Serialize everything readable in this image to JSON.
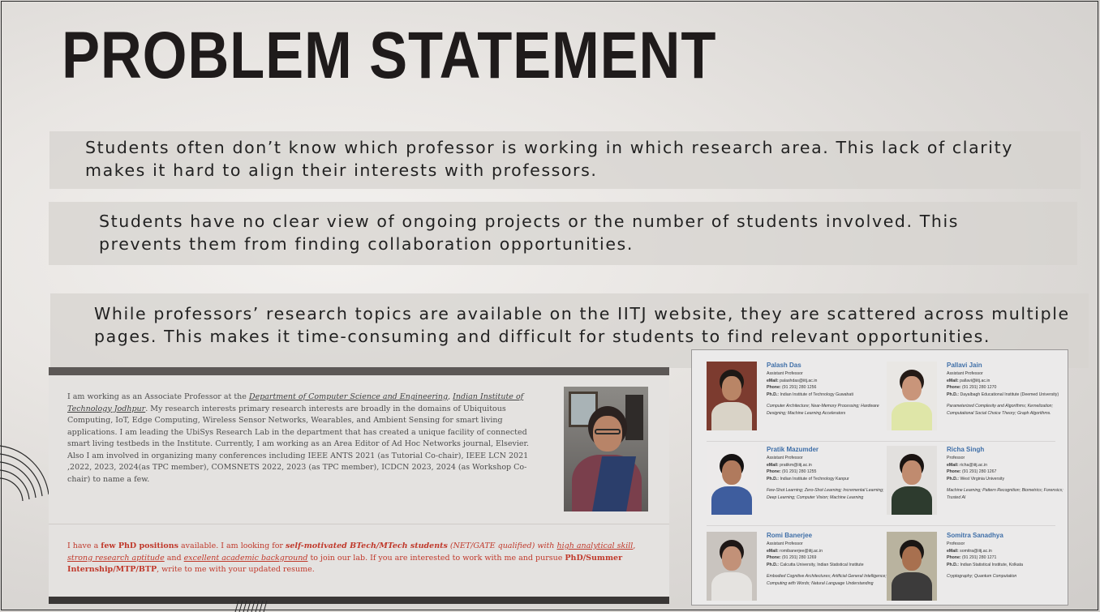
{
  "slide": {
    "title": "PROBLEM STATEMENT",
    "points": [
      "Students often don’t know which professor is working in which research area. This lack of clarity makes it hard to align their interests with professors.",
      "Students have no clear view of ongoing projects or the number of students involved. This prevents them from finding collaboration opportunities.",
      "While professors’ research topics are available on the IITJ website, they are scattered across multiple pages. This makes it time-consuming and difficult for students to find relevant opportunities."
    ],
    "point_lines": [
      [
        "Students often don’t know which professor is working in which research area. This lack of clarity",
        "makes it hard to align their interests with professors."
      ],
      [
        "Students have no clear view of ongoing projects or the number of students involved. This",
        "prevents them from finding collaboration opportunities."
      ],
      [
        "While professors’ research topics are available on the IITJ website, they are scattered across multiple",
        "pages. This makes it time-consuming and difficult for students to find relevant opportunities."
      ]
    ]
  },
  "profile_card": {
    "bio": {
      "p1": "I am working as an Associate Professor at the ",
      "dept_link": "Department of Computer Science and Engineering",
      "comma": ", ",
      "inst_link": "Indian Institute of Technology Jodhpur",
      "p2": ". My research interests primary research interests are broadly in the domains of Ubiquitous Computing, IoT, Edge Computing, Wireless Sensor Networks, Wearables, and Ambient Sensing for smart living applications. I am leading the UbiSys Research Lab in the department that has created a unique facility of connected smart living testbeds in the Institute. Currently, I am working as an Area Editor of Ad Hoc Networks journal, Elsevier. Also I am involved in organizing many conferences including IEEE ANTS 2021 (as Tutorial Co-chair), IEEE LCN 2021 ,2022, 2023, 2024(as TPC member), COMSNETS 2022, 2023 (as TPC member), ICDCN 2023, 2024 (as Workshop Co-chair) to name a few."
    },
    "phd": {
      "a": "I have a ",
      "b": "few PhD positions",
      "c": " available. I am looking for ",
      "d": "self-motivated BTech/MTech students",
      "e": " (NET/GATE qualified) with ",
      "f": "high analytical skill",
      "g": ", ",
      "h": "strong research aptitude",
      "i": " and ",
      "j": "excellent academic background",
      "k": " to join our lab. If you are interested to work with me and pursue ",
      "l": "PhD/Summer Internship/MTP/BTP",
      "m": ", write to me with your updated resume."
    }
  },
  "faculty": {
    "labels": {
      "email": "eMail:",
      "phone": "Phone:",
      "phd": "Ph.D.:"
    },
    "list": [
      {
        "name": "Palash Das",
        "role": "Assistant Professor",
        "email": "palashdas@iitj.ac.in",
        "phone": "(91 291) 280 1256",
        "phd": "Indian Institute of Technology Guwahati",
        "areas": "Computer Architecture; Near-Memory Processing; Hardware Designing; Machine Learning Accelerators",
        "colors": {
          "bg": "#7c3b2f",
          "hair": "#1d1815",
          "face": "#b98566",
          "shirt": "#d9d3c7"
        }
      },
      {
        "name": "Pallavi Jain",
        "role": "Assistant Professor",
        "email": "pallavi@iitj.ac.in",
        "phone": "(91 291) 280 1270",
        "phd": "Dayalbagh Educational Institute (Deemed University)",
        "areas": "Parameterized Complexity and Algorithms; Kernelization; Computational Social Choice Theory; Graph Algorithms.",
        "colors": {
          "bg": "#e9e7e4",
          "hair": "#241a16",
          "face": "#c9957a",
          "shirt": "#dfe6a8"
        }
      },
      {
        "name": "Pratik Mazumder",
        "role": "Assistant Professor",
        "email": "pratikm@iitj.ac.in",
        "phone": "(91 291) 280 1255",
        "phd": "Indian Institute of Technology Kanpur",
        "areas": "Few-Shot Learning; Zero-Shot Learning; Incremental Learning; Deep Learning; Computer Vision; Machine Learning",
        "colors": {
          "bg": "#eceaea",
          "hair": "#151212",
          "face": "#b07a5d",
          "shirt": "#3e5d9e"
        }
      },
      {
        "name": "Richa Singh",
        "role": "Professor",
        "email": "richa@iitj.ac.in",
        "phone": "(91 291) 280 1267",
        "phd": "West Virginia University",
        "areas": "Machine Learning; Pattern Recognition; Biometrics; Forensics; Trusted AI",
        "colors": {
          "bg": "#e2e0de",
          "hair": "#1a1311",
          "face": "#c08b6f",
          "shirt": "#2d3b2e"
        }
      },
      {
        "name": "Romi Banerjee",
        "role": "Assistant Professor",
        "email": "romibanerjee@iitj.ac.in",
        "phone": "(91 291) 280 1269",
        "phd": "Calcutta University, Indian Statistical Institute",
        "areas": "Embodied Cognitive Architectures; Artificial General Intelligence; Computing with Words; Natural Language Understanding",
        "colors": {
          "bg": "#c9c4bf",
          "hair": "#1e1716",
          "face": "#c29178",
          "shirt": "#e5e3e0"
        }
      },
      {
        "name": "Somitra Sanadhya",
        "role": "Professor",
        "email": "somitra@iitj.ac.in",
        "phone": "(91 291) 280 1271",
        "phd": "Indian Statistical Institute, Kolkata",
        "areas": "Cryptography; Quantum Computation",
        "colors": {
          "bg": "#b9b39f",
          "hair": "#1a1614",
          "face": "#a8704f",
          "shirt": "#3c3b3b"
        }
      }
    ]
  }
}
